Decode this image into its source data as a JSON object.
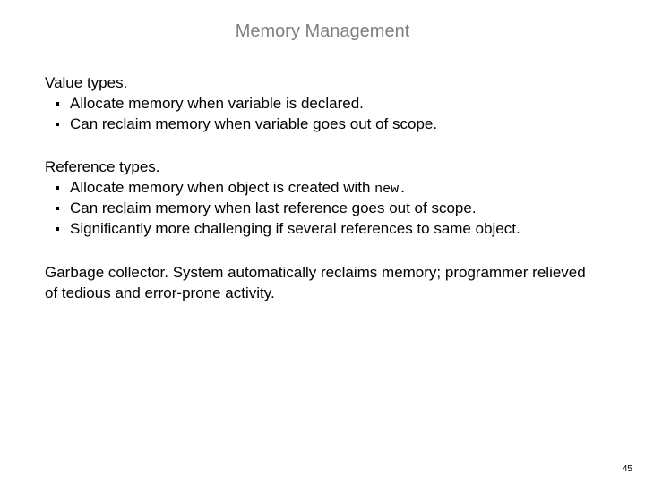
{
  "title": "Memory Management",
  "sections": [
    {
      "heading": "Value types.",
      "items": [
        "Allocate memory when variable is declared.",
        "Can reclaim memory when variable goes out of scope."
      ]
    },
    {
      "heading": "Reference types.",
      "items": [
        "Allocate memory when object is created with ",
        "Can reclaim memory when last reference goes out of scope.",
        "Significantly more challenging if several references to same object."
      ],
      "code_after_first": "new."
    }
  ],
  "paragraph": "Garbage collector.  System automatically reclaims memory; programmer relieved of tedious and error-prone activity.",
  "page_number": "45"
}
